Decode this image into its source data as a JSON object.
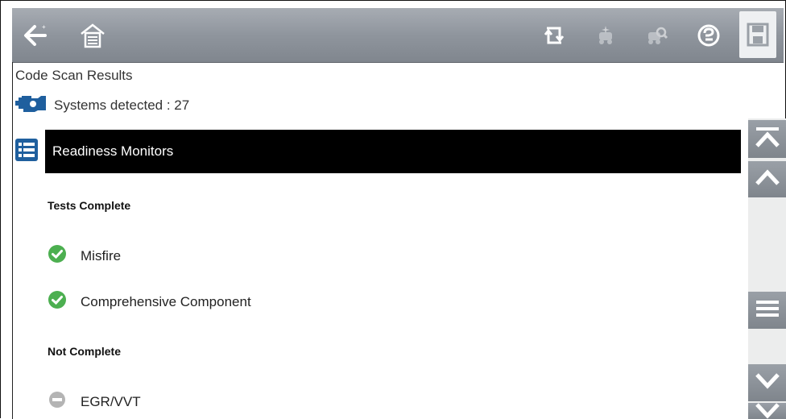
{
  "toolbar": {
    "back_icon": "back-arrow-icon",
    "home_icon": "home-icon",
    "icons": [
      "flip-icon",
      "vehicle-sparkle-icon",
      "vehicle-search-icon",
      "help-icon",
      "save-icon"
    ]
  },
  "page": {
    "title": "Code Scan Results",
    "systems_detected": "Systems detected : 27"
  },
  "section": {
    "title": "Readiness Monitors"
  },
  "groups": {
    "complete": {
      "heading": "Tests Complete",
      "items": [
        "Misfire",
        "Comprehensive Component"
      ]
    },
    "not_complete": {
      "heading": "Not Complete",
      "items": [
        "EGR/VVT"
      ]
    }
  },
  "colors": {
    "toolbar": "#8f959d",
    "check_green": "#4caf50",
    "pending_gray": "#b4b4b4",
    "section_bar": "#000000",
    "engine_blue": "#1f5f9e"
  }
}
